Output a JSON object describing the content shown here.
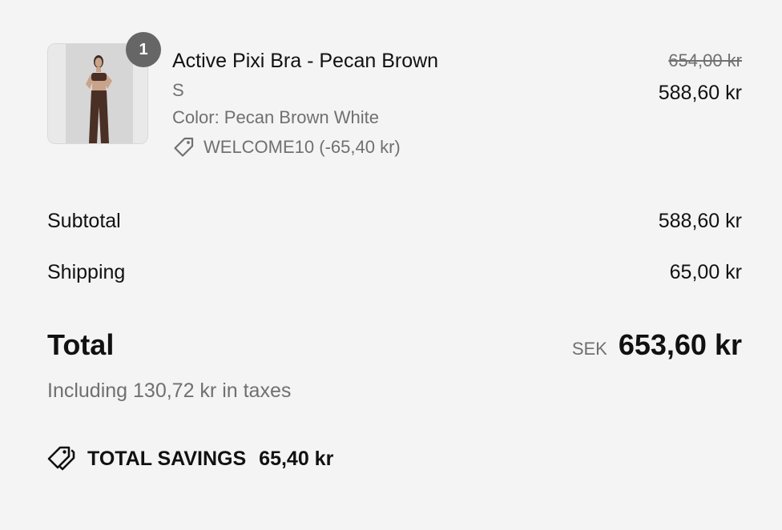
{
  "line_item": {
    "quantity": "1",
    "title": "Active Pixi Bra - Pecan Brown",
    "variant": "S",
    "color": "Color: Pecan Brown White",
    "discount": "WELCOME10 (-65,40 kr)",
    "original_price": "654,00 kr",
    "price": "588,60 kr",
    "image_icon": "product-photo"
  },
  "totals": {
    "subtotal_label": "Subtotal",
    "subtotal_value": "588,60 kr",
    "shipping_label": "Shipping",
    "shipping_value": "65,00 kr",
    "total_label": "Total",
    "currency": "SEK",
    "total_value": "653,60 kr",
    "taxes_note": "Including 130,72 kr in taxes"
  },
  "savings": {
    "label": "TOTAL SAVINGS",
    "value": "65,40 kr",
    "icon": "tags-icon"
  },
  "colors": {
    "background": "#f4f4f4",
    "text": "#111111",
    "muted": "#707070",
    "badge": "#666666"
  }
}
